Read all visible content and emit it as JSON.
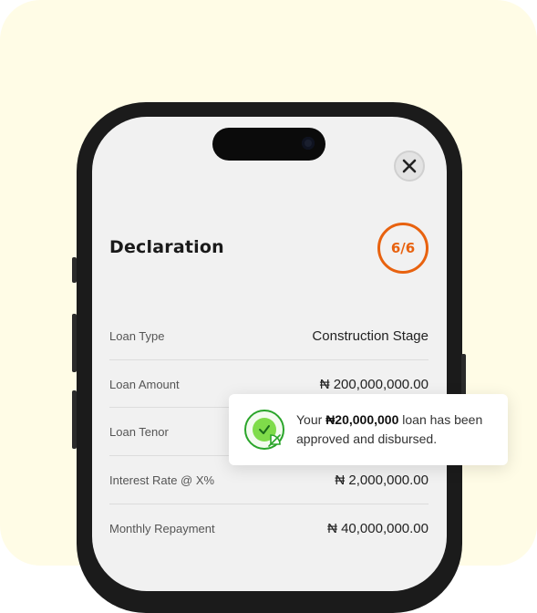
{
  "screen": {
    "title": "Declaration",
    "progress": "6/6",
    "close_icon": "close-icon"
  },
  "details": [
    {
      "label": "Loan Type",
      "value": "Construction Stage"
    },
    {
      "label": "Loan Amount",
      "value": "₦ 200,000,000.00"
    },
    {
      "label": "Loan Tenor",
      "value": ""
    },
    {
      "label": "Interest Rate @ X%",
      "value": "₦ 2,000,000.00"
    },
    {
      "label": "Monthly Repayment",
      "value": "₦ 40,000,000.00"
    }
  ],
  "toast": {
    "prefix": "Your ",
    "amount": "₦20,000,000",
    "suffix": " loan has been approved and disbursed.",
    "icon": "verified-badge-icon"
  },
  "colors": {
    "background": "#fffce6",
    "accent": "#e8620f",
    "success": "#2aa52a"
  }
}
